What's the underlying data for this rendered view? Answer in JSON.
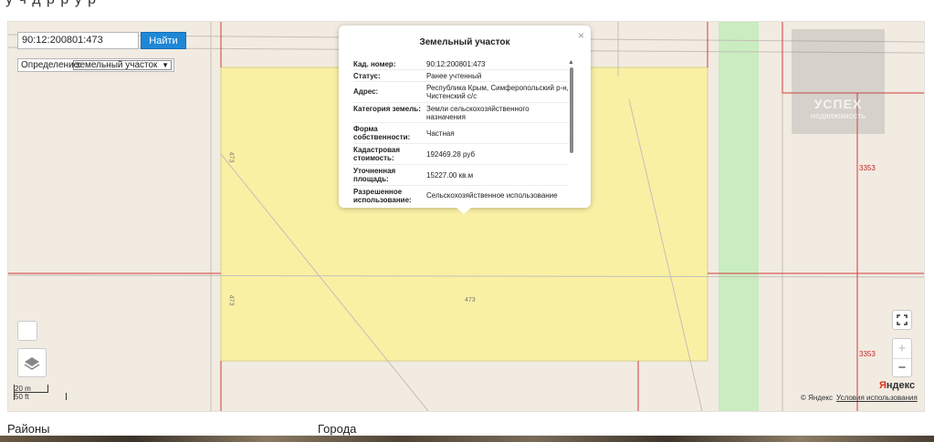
{
  "header": {
    "title_fragment": "у   ч        д   р    р         у     р"
  },
  "search": {
    "value": "90:12:200801:473",
    "button_label": "Найти",
    "definition_label": "Определение:",
    "definition_value": "земельный участок"
  },
  "popup": {
    "title": "Земельный участок",
    "rows": [
      {
        "key": "Кад. номер:",
        "value": "90:12:200801:473"
      },
      {
        "key": "Статус:",
        "value": "Ранее учтенный"
      },
      {
        "key": "Адрес:",
        "value": "Республика Крым, Симферопольский р-н, Чистенский с/с"
      },
      {
        "key": "Категория земель:",
        "value": "Земли сельскохозяйственного назначения"
      },
      {
        "key": "Форма собственности:",
        "value": "Частная"
      },
      {
        "key": "Кадастровая стоимость:",
        "value": "192469.28 руб"
      },
      {
        "key": "Уточненная площадь:",
        "value": "15227.00 кв.м"
      },
      {
        "key": "Разрешенное использование:",
        "value": "Сельскохозяйственное использование"
      }
    ]
  },
  "map_labels": {
    "parcel_top": "473",
    "parcel_left": "473",
    "parcel_center": "473",
    "right_top": "3353",
    "right_bottom": "3353"
  },
  "scale": {
    "meters": "20 m",
    "feet": "50 ft"
  },
  "watermark": {
    "brand": "УСПЕХ",
    "sub": "недвижимость"
  },
  "attribution": {
    "logo_a": "Я",
    "logo_b": "ндекс",
    "copyright": "© Яндекс",
    "terms": "Условия использования"
  },
  "controls": {
    "fullscreen": "fullscreen-icon",
    "zoom_in": "+",
    "zoom_out": "−",
    "layers": "layers-icon"
  },
  "footer": {
    "districts": "Районы",
    "cities": "Города"
  },
  "colors": {
    "parcel_fill": "#faf0a4",
    "boundary": "#d23b3b",
    "green_strip": "#c9ecc0",
    "accent": "#1e87d6"
  }
}
